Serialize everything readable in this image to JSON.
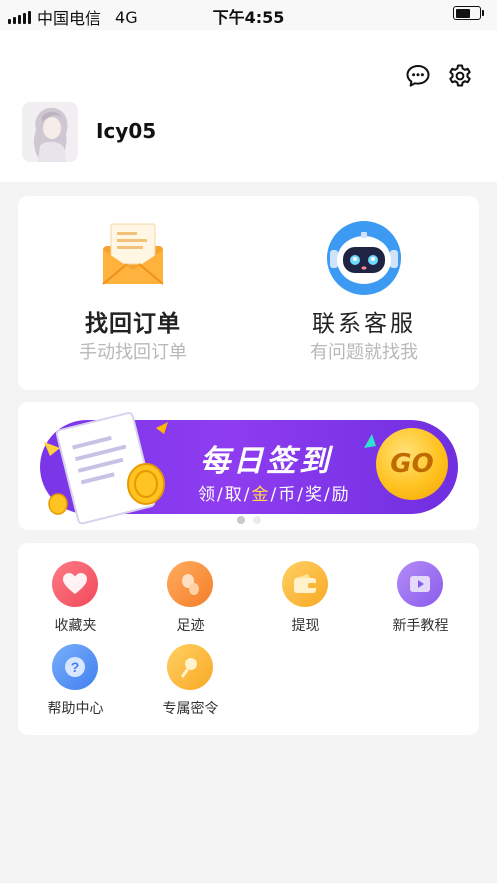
{
  "status_bar": {
    "carrier": "中国电信",
    "network": "4G",
    "time": "下午4:55",
    "battery_level": 0.6
  },
  "profile": {
    "username": "Icy05",
    "message_icon": "chat-bubble-icon",
    "settings_icon": "gear-icon"
  },
  "actions": [
    {
      "title": "找回订单",
      "subtitle": "手动找回订单",
      "icon": "envelope-icon"
    },
    {
      "title": "联系客服",
      "subtitle": "有问题就找我",
      "icon": "robot-icon"
    }
  ],
  "banner": {
    "title": "每日签到",
    "subtitle_parts": [
      "领",
      "/",
      "取",
      "/",
      "金",
      "/",
      "币",
      "/",
      "奖",
      "/",
      "励"
    ],
    "go_label": "GO",
    "page_count": 2,
    "active_page": 1
  },
  "menu": [
    {
      "label": "收藏夹",
      "icon": "heart-icon",
      "color": "#ff5f6d"
    },
    {
      "label": "足迹",
      "icon": "footprint-icon",
      "color": "#ff8a3d"
    },
    {
      "label": "提现",
      "icon": "wallet-icon",
      "color": "#ffb62e"
    },
    {
      "label": "新手教程",
      "icon": "video-play-icon",
      "color": "#9a6cf2"
    },
    {
      "label": "帮助中心",
      "icon": "question-icon",
      "color": "#4f8ef7"
    },
    {
      "label": "专属密令",
      "icon": "key-icon",
      "color": "#ffb62e"
    }
  ],
  "colors": {
    "banner_purple": "#7a36e8",
    "gold": "#ffc21f",
    "subtitle_gray": "#b8b8b8",
    "background": "#f4f4f5"
  }
}
